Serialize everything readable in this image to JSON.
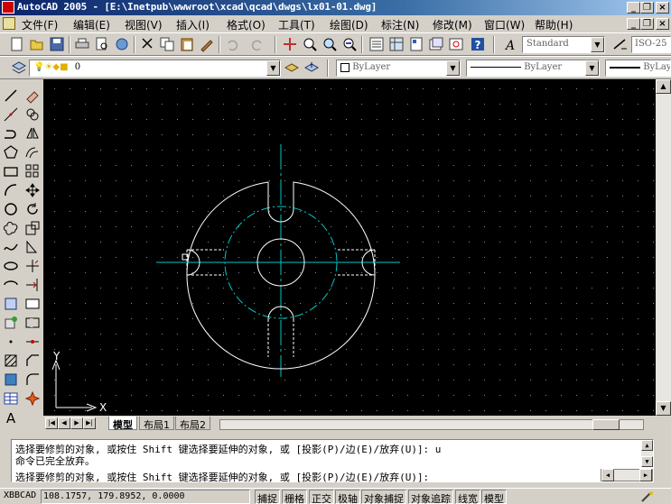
{
  "window": {
    "title": "AutoCAD 2005 - [E:\\Inetpub\\wwwroot\\xcad\\qcad\\dwgs\\lx01-01.dwg]",
    "controls": {
      "minimize": "_",
      "restore": "❐",
      "close": "×"
    }
  },
  "menu": [
    "文件(F)",
    "编辑(E)",
    "视图(V)",
    "插入(I)",
    "格式(O)",
    "工具(T)",
    "绘图(D)",
    "标注(N)",
    "修改(M)",
    "窗口(W)",
    "帮助(H)"
  ],
  "toolbar": {
    "text_style": "Standard",
    "dim_style": "ISO-25",
    "layer": "0",
    "color": "ByLayer",
    "linetype": "ByLayer",
    "lineweight": "ByLayer"
  },
  "colors": {
    "canvas_bg": "#000000",
    "outline": "#ffffff",
    "centerline": "#00c8c8",
    "hidden": "#ffffff"
  },
  "ucs": {
    "x_label": "X",
    "y_label": "Y"
  },
  "tabs": {
    "model": "模型",
    "layout1": "布局1",
    "layout2": "布局2"
  },
  "command": {
    "line1": "选择要修剪的对象, 或按住 Shift 键选择要延伸的对象, 或 [投影(P)/边(E)/放弃(U)]: u",
    "line2": "命令已完全放弃。",
    "line3": "选择要修剪的对象, 或按住 Shift 键选择要延伸的对象, 或 [投影(P)/边(E)/放弃(U)]:"
  },
  "status": {
    "app": "XBBCAD",
    "coords": "108.1757,  179.8952,  0.0000",
    "toggles": [
      "捕捉",
      "栅格",
      "正交",
      "极轴",
      "对象捕捉",
      "对象追踪",
      "线宽",
      "模型"
    ]
  }
}
